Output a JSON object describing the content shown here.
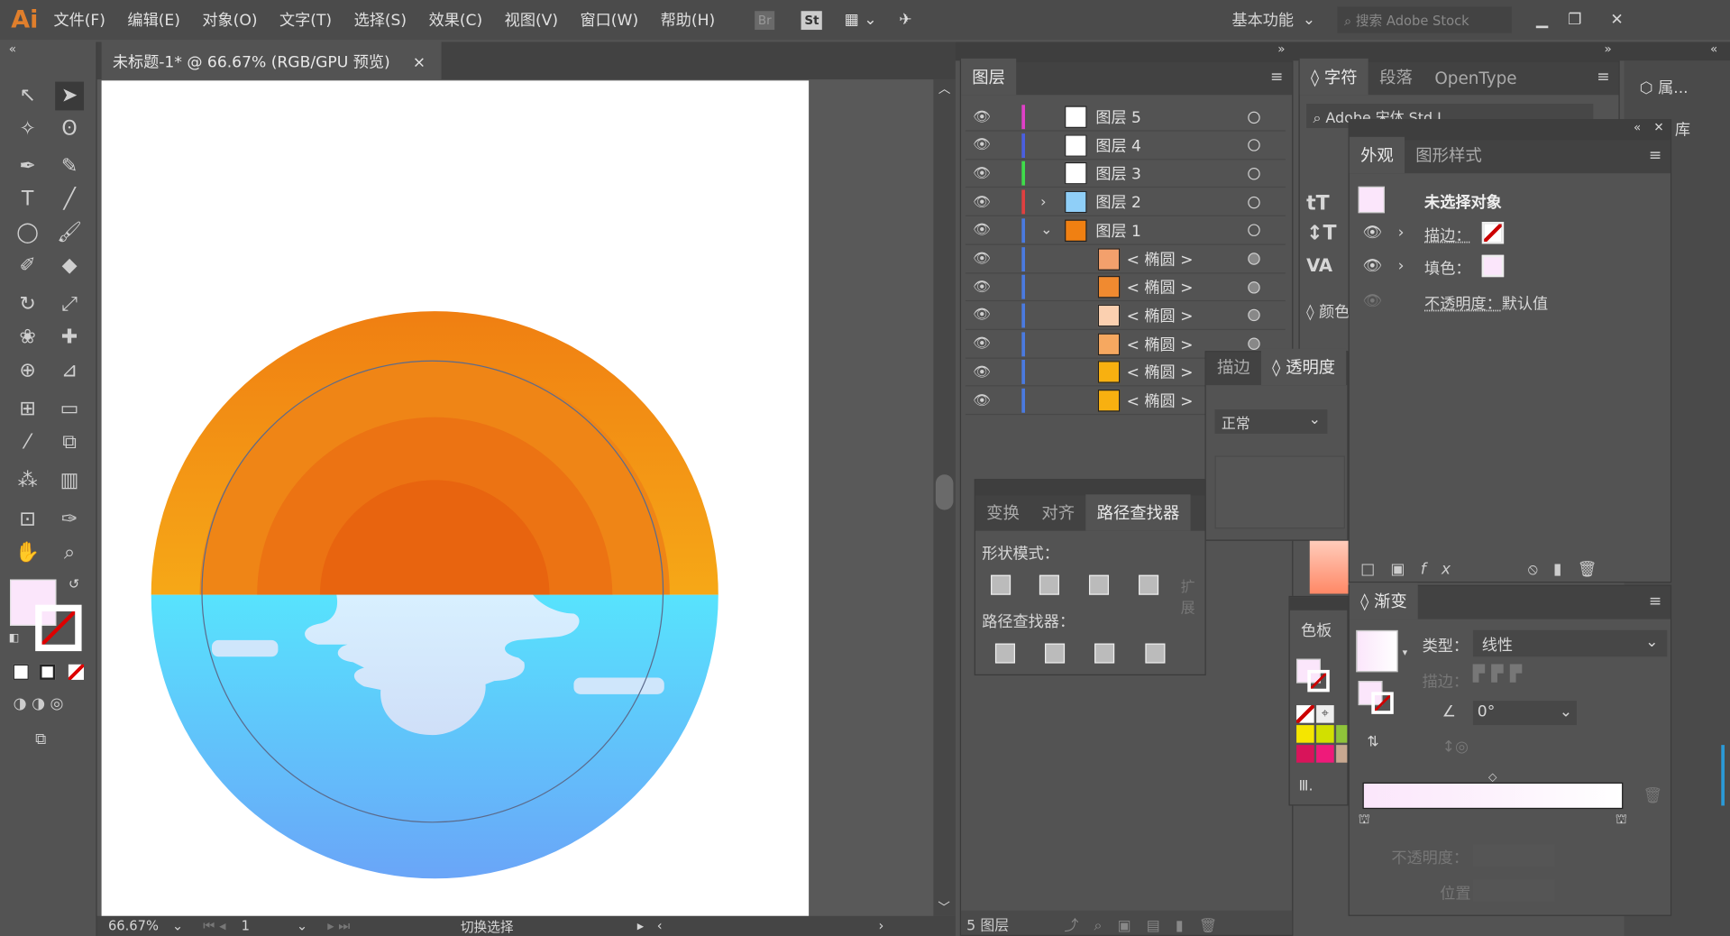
{
  "app": {
    "logo": "Ai",
    "menus": [
      "文件(F)",
      "编辑(E)",
      "对象(O)",
      "文字(T)",
      "选择(S)",
      "效果(C)",
      "视图(V)",
      "窗口(W)",
      "帮助(H)"
    ],
    "bridge": "Br",
    "stock": "St",
    "workspace": "基本功能",
    "search_placeholder": "搜索 Adobe Stock"
  },
  "document": {
    "tab_title": "未标题-1* @ 66.67% (RGB/GPU 预览)",
    "close": "×"
  },
  "status": {
    "zoom": "66.67%",
    "page": "1",
    "message": "切换选择"
  },
  "artwork": {
    "sun_top": "#f07f12",
    "sun_bottom": "#f6a817",
    "ring1": "#ef8516",
    "ring2": "#ec7313",
    "ring3": "#e8640f",
    "water_top": "#57e3fd",
    "water_bottom": "#6aa5f8",
    "reflection": "#cfe6fb"
  },
  "layers": {
    "title": "图层",
    "footer": "5 图层",
    "rows": [
      {
        "name": "图层 5",
        "color": "#e040c8",
        "thumb": "#ffffff"
      },
      {
        "name": "图层 4",
        "color": "#4a5fe0",
        "thumb": "#ffffff"
      },
      {
        "name": "图层 3",
        "color": "#3fdc4a",
        "thumb": "#ffffff"
      },
      {
        "name": "图层 2",
        "color": "#e04040",
        "thumb": "#8fcff8",
        "toggle": "›"
      },
      {
        "name": "图层 1",
        "color": "#4a7ae0",
        "thumb": "#f08012",
        "toggle": "⌄"
      },
      {
        "name": "< 椭圆 >",
        "color": "#4a7ae0",
        "thumb": "#f3a06c"
      },
      {
        "name": "< 椭圆 >",
        "color": "#4a7ae0",
        "thumb": "#f08a30"
      },
      {
        "name": "< 椭圆 >",
        "color": "#4a7ae0",
        "thumb": "#fbd0b0"
      },
      {
        "name": "< 椭圆 >",
        "color": "#4a7ae0",
        "thumb": "#f6a860"
      },
      {
        "name": "< 椭圆 >",
        "color": "#4a7ae0",
        "thumb": "#f8b010"
      },
      {
        "name": "< 椭圆 >",
        "color": "#4a7ae0",
        "thumb": "#f8b010"
      }
    ]
  },
  "character": {
    "tabs": [
      "字符",
      "段落",
      "OpenType"
    ],
    "font": "Adobe 宋体 Std L",
    "color_tab": "颜色"
  },
  "appearance": {
    "tabs": [
      "外观",
      "图形样式"
    ],
    "no_selection": "未选择对象",
    "stroke_label": "描边：",
    "fill_label": "填色：",
    "opacity_label": "不透明度：",
    "opacity_value": "默认值"
  },
  "transparency": {
    "tabs": [
      "描边",
      "透明度"
    ],
    "mode": "正常"
  },
  "pathfinder": {
    "tabs": [
      "变换",
      "对齐",
      "路径查找器"
    ],
    "shape_modes": "形状模式：",
    "expand": "扩展",
    "pathfinders": "路径查找器："
  },
  "swatches": {
    "title": "色板",
    "colors": [
      "#f5e600",
      "#d2e000",
      "#8fc43a",
      "#d8145a",
      "#ef1a7a",
      "#c8a890"
    ]
  },
  "gradient": {
    "title": "渐变",
    "type_label": "类型：",
    "type_value": "线性",
    "stroke_label": "描边：",
    "angle": "0°",
    "opacity_label": "不透明度：",
    "location_label": "位置：",
    "start_color": "#fbe6fb",
    "end_color": "#ffffff"
  },
  "right_strip": {
    "properties": "属...",
    "libraries": "库"
  }
}
